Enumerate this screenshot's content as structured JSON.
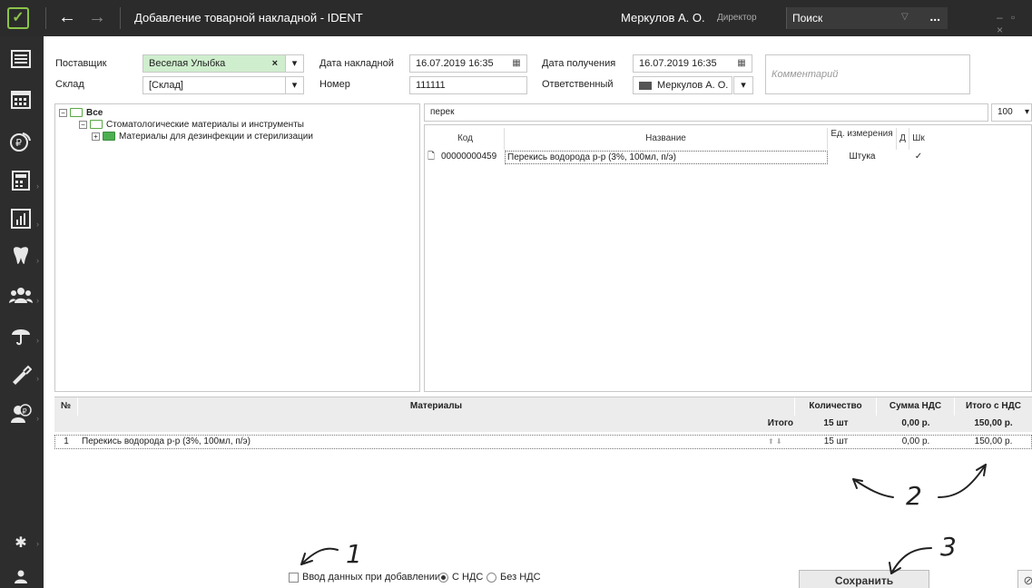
{
  "titlebar": {
    "title": "Добавление товарной накладной - IDENT",
    "user": "Меркулов А. О.",
    "role": "Директор",
    "search_placeholder": "Поиск",
    "search_more": "..."
  },
  "form": {
    "supplier_label": "Поставщик",
    "supplier_value": "Веселая Улыбка",
    "warehouse_label": "Склад",
    "warehouse_value": "[Склад]",
    "invoice_date_label": "Дата накладной",
    "invoice_date_value": "16.07.2019 16:35",
    "number_label": "Номер",
    "number_value": "111111",
    "receipt_date_label": "Дата получения",
    "receipt_date_value": "16.07.2019 16:35",
    "responsible_label": "Ответственный",
    "responsible_value": "Меркулов А. О.",
    "comment_placeholder": "Комментарий"
  },
  "tree": {
    "root": "Все",
    "child": "Стоматологические материалы и инструменты",
    "grandchild": "Материалы для дезинфекции и стерилизации"
  },
  "search": {
    "query": "перек",
    "limit": "100"
  },
  "results": {
    "headers": {
      "code": "Код",
      "name": "Название",
      "unit": "Ед. измерения",
      "d": "Д",
      "sh": "Шк"
    },
    "rows": [
      {
        "code": "00000000459",
        "name": "Перекись водорода р-р (3%, 100мл, п/э)",
        "unit": "Штука",
        "d": "",
        "sh": "✓"
      }
    ]
  },
  "materials": {
    "headers": {
      "num": "№",
      "name": "Материалы",
      "qty": "Количество",
      "vat": "Сумма НДС",
      "total": "Итого с НДС"
    },
    "totals": {
      "label": "Итого",
      "qty": "15 шт",
      "vat": "0,00 р.",
      "total": "150,00 р."
    },
    "rows": [
      {
        "num": "1",
        "name": "Перекись водорода р-р (3%, 100мл, п/э)",
        "qty": "15 шт",
        "vat": "0,00 р.",
        "total": "150,00 р."
      }
    ]
  },
  "bottom": {
    "enter_on_add": "Ввод данных при добавлении",
    "with_vat": "С НДС",
    "without_vat": "Без НДС",
    "save": "Сохранить"
  },
  "annotations": {
    "a1": "1",
    "a2": "2",
    "a3": "3"
  },
  "colors": {
    "titlebar": "#2b2b2b",
    "accent_green": "#8bc34a",
    "supplier_field": "#cfeecd",
    "header_gray": "#ececec"
  }
}
